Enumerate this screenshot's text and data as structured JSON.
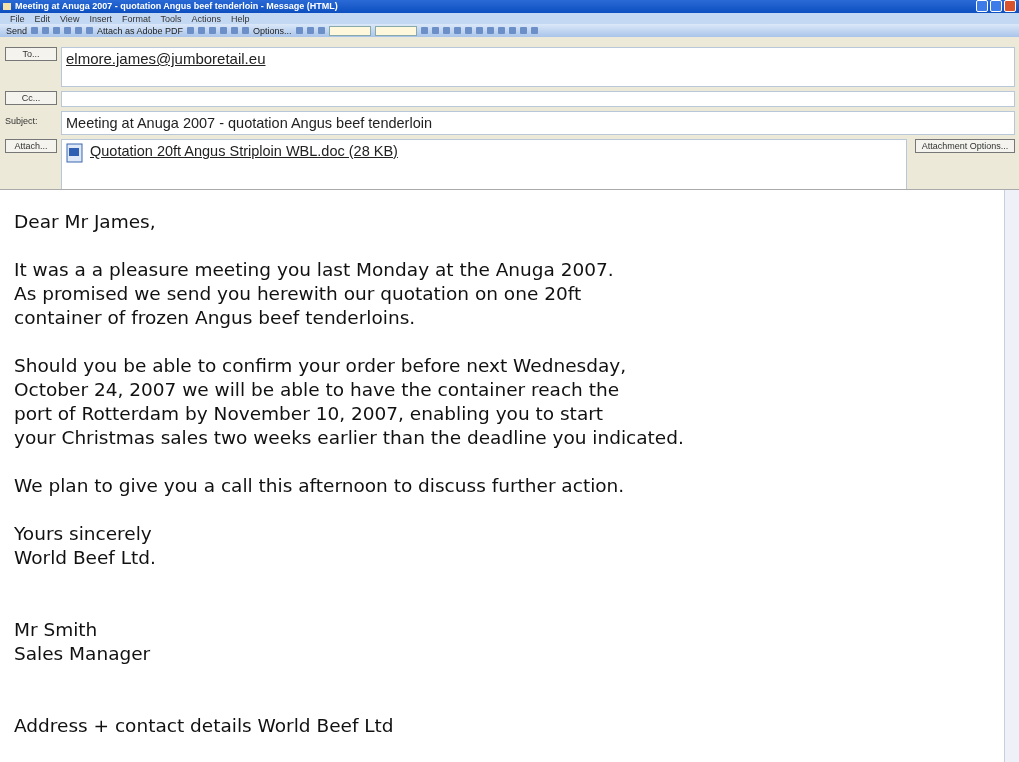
{
  "window": {
    "title": "Meeting at Anuga 2007 - quotation Angus beef tenderloin - Message (HTML)"
  },
  "menu": [
    "File",
    "Edit",
    "View",
    "Insert",
    "Format",
    "Tools",
    "Actions",
    "Help"
  ],
  "toolbar": [
    {
      "kind": "text",
      "label": "Send"
    },
    {
      "kind": "icon"
    },
    {
      "kind": "icon"
    },
    {
      "kind": "icon"
    },
    {
      "kind": "icon"
    },
    {
      "kind": "icon"
    },
    {
      "kind": "icon"
    },
    {
      "kind": "text",
      "label": "Attach as Adobe PDF"
    },
    {
      "kind": "icon"
    },
    {
      "kind": "icon"
    },
    {
      "kind": "icon"
    },
    {
      "kind": "icon"
    },
    {
      "kind": "icon"
    },
    {
      "kind": "icon"
    },
    {
      "kind": "text",
      "label": "Options..."
    },
    {
      "kind": "icon"
    },
    {
      "kind": "icon"
    },
    {
      "kind": "icon"
    },
    {
      "kind": "dropdown"
    },
    {
      "kind": "dropdown"
    },
    {
      "kind": "icon"
    },
    {
      "kind": "icon"
    },
    {
      "kind": "icon"
    },
    {
      "kind": "icon"
    },
    {
      "kind": "icon"
    },
    {
      "kind": "icon"
    },
    {
      "kind": "icon"
    },
    {
      "kind": "icon"
    },
    {
      "kind": "icon"
    },
    {
      "kind": "icon"
    },
    {
      "kind": "icon"
    }
  ],
  "header": {
    "to_button": "To...",
    "to": "elmore.james@jumboretail.eu",
    "cc_button": "Cc...",
    "subject_label": "Subject:",
    "subject": "Meeting at Anuga 2007 - quotation Angus beef tenderloin",
    "attach_button": "Attach...",
    "attachment": "Quotation 20ft Angus Striploin WBL.doc (28 KB)",
    "attachment_options": "Attachment Options..."
  },
  "body": [
    "Dear Mr James,",
    "It was a a pleasure meeting you last Monday at the Anuga 2007.\nAs promised we send you herewith our quotation on one 20ft\ncontainer of frozen Angus beef tenderloins.",
    "Should you be able to confirm your order before next Wednesday,\nOctober 24, 2007 we will be able to have the container reach the\nport of Rotterdam by November 10, 2007, enabling you to start\nyour Christmas sales two weeks earlier than the deadline you indicated.",
    "We plan to give you a call this afternoon to discuss further action.",
    "Yours sincerely\nWorld Beef Ltd.",
    "\nMr Smith\nSales Manager",
    "\nAddress + contact details World Beef Ltd"
  ]
}
